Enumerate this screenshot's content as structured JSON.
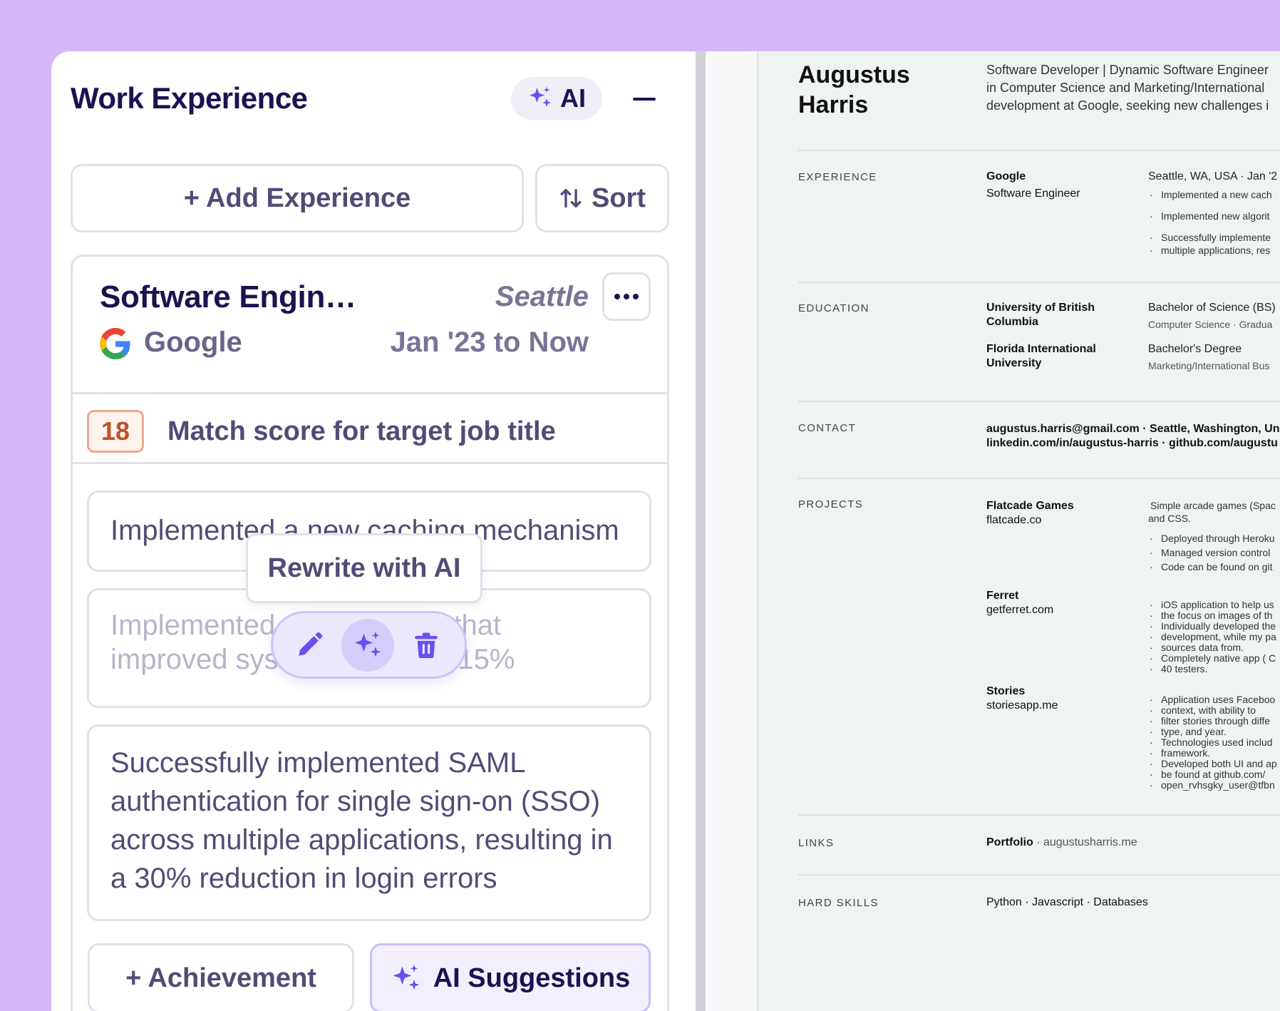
{
  "panel": {
    "title": "Work Experience",
    "ai_label": "AI",
    "add_experience": "+ Add Experience",
    "sort_label": "Sort",
    "colors": {
      "accent": "#6a4ff2",
      "ink": "#1e1150",
      "muted": "#554a76",
      "bg": "#d5b8f8"
    }
  },
  "experience": {
    "title": "Software Engin…",
    "location": "Seattle",
    "company": "Google",
    "dates": "Jan '23 to Now",
    "match_score": "18",
    "match_text": "Match score for target job title",
    "bullets": [
      "Implemented a new caching mechanism",
      "Implemented new algorithm that improved system efficiency by 15%",
      "Successfully implemented SAML authentication for single sign-on (SSO) across multiple applications, resulting in a 30% reduction in login errors"
    ],
    "bullet2_line1_a": "Implemented",
    "bullet2_line1_b": "n that",
    "bullet2_line2_a": "improved sys",
    "bullet2_line2_b": "by 15%",
    "tooltip": "Rewrite with AI",
    "add_achievement": "+ Achievement",
    "ai_suggestions": "AI Suggestions"
  },
  "resume": {
    "name_line1": "Augustus",
    "name_line2": "Harris",
    "summary_lines": [
      "Software Developer | Dynamic Software Engineer",
      "in Computer Science and Marketing/International",
      "development at Google, seeking new challenges i"
    ],
    "sections": {
      "experience": "EXPERIENCE",
      "education": "EDUCATION",
      "contact": "CONTACT",
      "projects": "PROJECTS",
      "links": "LINKS",
      "hard_skills": "HARD SKILLS"
    },
    "exp": {
      "company": "Google",
      "role": "Software Engineer",
      "meta": "Seattle, WA, USA · Jan '2",
      "bullets": [
        "Implemented a new cach",
        "Implemented new algorit",
        "Successfully implemente",
        "multiple applications, res"
      ]
    },
    "edu": [
      {
        "school1": "University of British",
        "school2": "Columbia",
        "degree": "Bachelor of Science (BS)",
        "field": "Computer Science · Gradua"
      },
      {
        "school1": "Florida International",
        "school2": "University",
        "degree": "Bachelor's Degree",
        "field": "Marketing/International Bus"
      }
    ],
    "contact": {
      "line1": "augustus.harris@gmail.com · Seattle, Washington, Uni",
      "line2": "linkedin.com/in/augustus-harris · github.com/augustu"
    },
    "projects": [
      {
        "name": "Flatcade Games",
        "url": "flatcade.co",
        "desc1": "Simple arcade games (Spac",
        "desc2": "and CSS.",
        "bullets": [
          "Deployed through Heroku",
          "Managed version control",
          "Code can be found on git"
        ]
      },
      {
        "name": "Ferret",
        "url": "getferret.com",
        "bullets": [
          "iOS application to help us",
          "the focus on images of th",
          "Individually developed the",
          "development, while my pa",
          "sources data from.",
          "Completely native app ( C",
          "40 testers."
        ]
      },
      {
        "name": "Stories",
        "url": "storiesapp.me",
        "bullets": [
          "Application uses Faceboo",
          "context, with ability to",
          "filter stories through diffe",
          "type, and year.",
          "Technologies used includ",
          "framework.",
          "Developed both UI and ap",
          "be found at github.com/",
          "open_rvhsgky_user@tfbn"
        ]
      }
    ],
    "links": {
      "label": "Portfolio",
      "url": "augustusharris.me"
    },
    "skills": "Python · Javascript · Databases"
  }
}
